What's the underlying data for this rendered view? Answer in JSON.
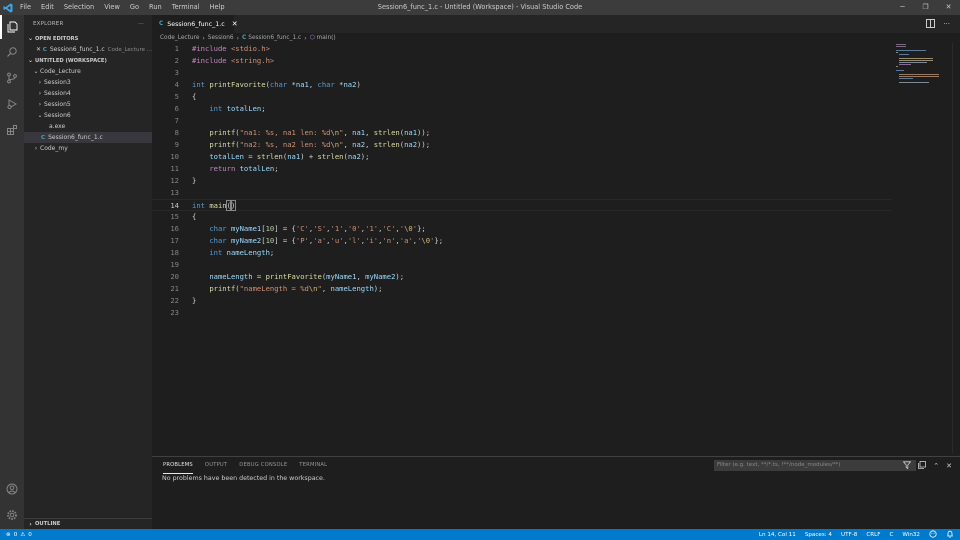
{
  "titlebar": {
    "menu": [
      "File",
      "Edit",
      "Selection",
      "View",
      "Go",
      "Run",
      "Terminal",
      "Help"
    ],
    "window_title": "Session6_func_1.c - Untitled (Workspace) - Visual Studio Code",
    "minimize_glyph": "─",
    "restore_glyph": "❐",
    "close_glyph": "✕"
  },
  "sidebar": {
    "header": "EXPLORER",
    "more_glyph": "···",
    "open_editors_label": "OPEN EDITORS",
    "open_editor": {
      "close_glyph": "✕",
      "icon_text": "C",
      "name": "Session6_func_1.c",
      "path": "Code_Lecture ..."
    },
    "workspace_label": "UNTITLED (WORKSPACE)",
    "tree": [
      {
        "name": "Code_Lecture",
        "chevron": "⌄"
      },
      {
        "name": "Session3",
        "chevron": "›"
      },
      {
        "name": "Session4",
        "chevron": "›"
      },
      {
        "name": "Session5",
        "chevron": "›"
      },
      {
        "name": "Session6",
        "chevron": "⌄"
      },
      {
        "name": "a.exe"
      },
      {
        "name": "Session6_func_1.c",
        "icon_text": "C"
      },
      {
        "name": "Code_my",
        "chevron": "›"
      }
    ],
    "outline_label": "OUTLINE"
  },
  "editor": {
    "tab": {
      "icon_text": "C",
      "label": "Session6_func_1.c",
      "close_glyph": "✕"
    },
    "breadcrumb": {
      "parts": [
        "Code_Lecture",
        "Session6",
        "Session6_func_1.c",
        "main()"
      ],
      "sep": "›",
      "file_icon": "C",
      "symbol_icon": "⬡"
    },
    "line_numbers": [
      "1",
      "2",
      "3",
      "4",
      "5",
      "6",
      "7",
      "8",
      "9",
      "10",
      "11",
      "12",
      "13",
      "14",
      "15",
      "16",
      "17",
      "18",
      "19",
      "20",
      "21",
      "22",
      "23"
    ],
    "current_line": 14
  },
  "panel": {
    "tabs": [
      "PROBLEMS",
      "OUTPUT",
      "DEBUG CONSOLE",
      "TERMINAL"
    ],
    "filter_placeholder": "Filter (e.g. text, **/*.ts, !**/node_modules/**)",
    "message": "No problems have been detected in the workspace."
  },
  "statusbar": {
    "errors": "0",
    "warnings": "0",
    "error_glyph": "⊗",
    "warning_glyph": "⚠",
    "position": "Ln 14, Col 11",
    "spaces": "Spaces: 4",
    "encoding": "UTF-8",
    "eol": "CRLF",
    "language": "C",
    "platform": "Win32"
  },
  "colors": {
    "titlebar": "#3c3c3c",
    "activitybar": "#333333",
    "sidebar": "#252526",
    "editor": "#1e1e1e",
    "statusbar": "#007acc",
    "keyword": "#569cd6",
    "preprocessor": "#c586c0",
    "string": "#ce9178",
    "function": "#dcdcaa",
    "variable": "#9cdcfe"
  }
}
